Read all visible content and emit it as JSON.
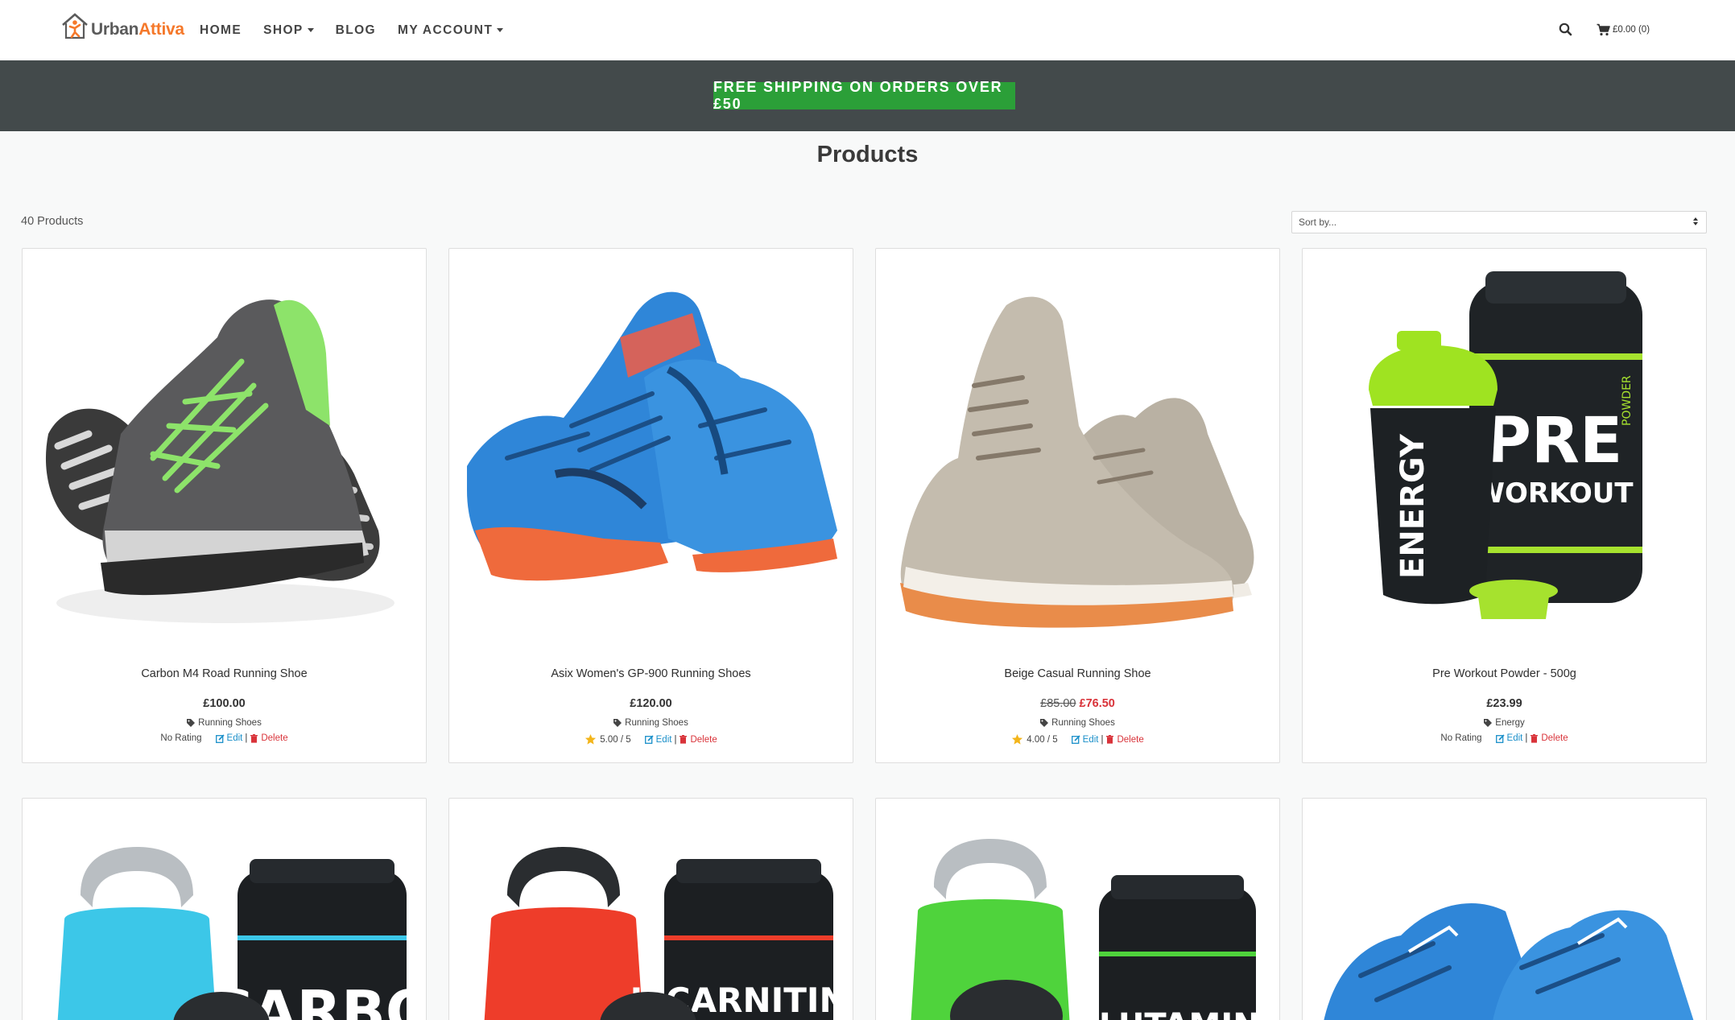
{
  "brand": {
    "name_part1": "Urban",
    "name_part2": "Attiva"
  },
  "nav": {
    "items": [
      {
        "label": "HOME",
        "dropdown": false
      },
      {
        "label": "SHOP",
        "dropdown": true
      },
      {
        "label": "BLOG",
        "dropdown": false
      },
      {
        "label": "MY ACCOUNT",
        "dropdown": true
      }
    ],
    "cart_label": "£0.00 (0)"
  },
  "banner": {
    "text": "FREE SHIPPING ON ORDERS OVER £50"
  },
  "page": {
    "title": "Products",
    "count_label": "40 Products",
    "sort_placeholder": "Sort by..."
  },
  "actions": {
    "edit_label": "Edit",
    "separator": "|",
    "delete_label": "Delete"
  },
  "products": [
    {
      "name": "Carbon M4 Road Running Shoe",
      "price": "£100.00",
      "old_price": "",
      "category": "Running Shoes",
      "rating": "No Rating",
      "has_rating": false
    },
    {
      "name": "Asix Women's GP-900 Running Shoes",
      "price": "£120.00",
      "old_price": "",
      "category": "Running Shoes",
      "rating": "5.00 / 5",
      "has_rating": true
    },
    {
      "name": "Beige Casual Running Shoe",
      "price": "£76.50",
      "old_price": "£85.00",
      "category": "Running Shoes",
      "rating": "4.00 / 5",
      "has_rating": true
    },
    {
      "name": "Pre Workout Powder - 500g",
      "price": "£23.99",
      "old_price": "",
      "category": "Energy",
      "rating": "No Rating",
      "has_rating": false
    }
  ],
  "product_image_text": {
    "preworkout_line1": "PRE",
    "preworkout_line2": "WORKOUT",
    "preworkout_side": "POWDER",
    "preworkout_shaker": "ENERGY",
    "row2_tub1": "CARBO",
    "row2_tub2": "L-CARNITINE",
    "row2_tub3": "GLUTAMINE"
  },
  "colors": {
    "accent_green": "#2b9f38",
    "banner_bg": "#434a4b",
    "brand_orange": "#f5782a",
    "link_blue": "#1a8fc9",
    "danger_red": "#d9333a",
    "star_yellow": "#f3b51b"
  },
  "icons": [
    "search-icon",
    "cart-icon",
    "tag-icon",
    "star-icon",
    "edit-icon",
    "trash-icon"
  ]
}
